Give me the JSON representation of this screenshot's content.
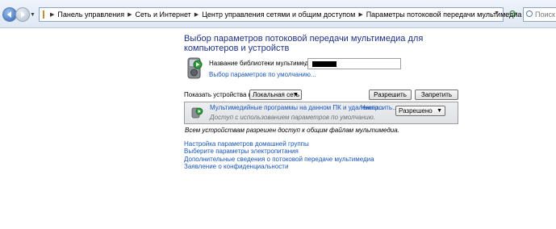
{
  "nav": {
    "breadcrumbs": [
      "Панель управления",
      "Сеть и Интернет",
      "Центр управления сетями и общим доступом",
      "Параметры потоковой передачи мультимедиа"
    ],
    "search_placeholder": "Поиск"
  },
  "main": {
    "title": "Выбор параметров потоковой передачи мультимедиа для компьютеров и устройств",
    "library_label": "Название библиотеки мультимедиа:",
    "library_value": "",
    "defaults_link": "Выбор параметров по умолчанию...",
    "show_devices_label": "Показать устройства на:",
    "network_selected": "Локальная сеть",
    "allow_all_label": "Разрешить все",
    "block_all_label": "Запретить все",
    "device": {
      "title": "Мультимедийные программы на данном ПК и удаленны...",
      "configure_link": "Настроить...",
      "description": "Доступ с использованием параметров по умолчанию.",
      "permission": "Разрешено"
    },
    "all_allowed_text": "Всем устройствам разрешен доступ к общим файлам мультимедиа.",
    "links": [
      "Настройка параметров домашней группы",
      "Выберите параметры электропитания",
      "Дополнительные сведения о потоковой передаче мультимедиа",
      "Заявление о конфиденциальности"
    ]
  }
}
